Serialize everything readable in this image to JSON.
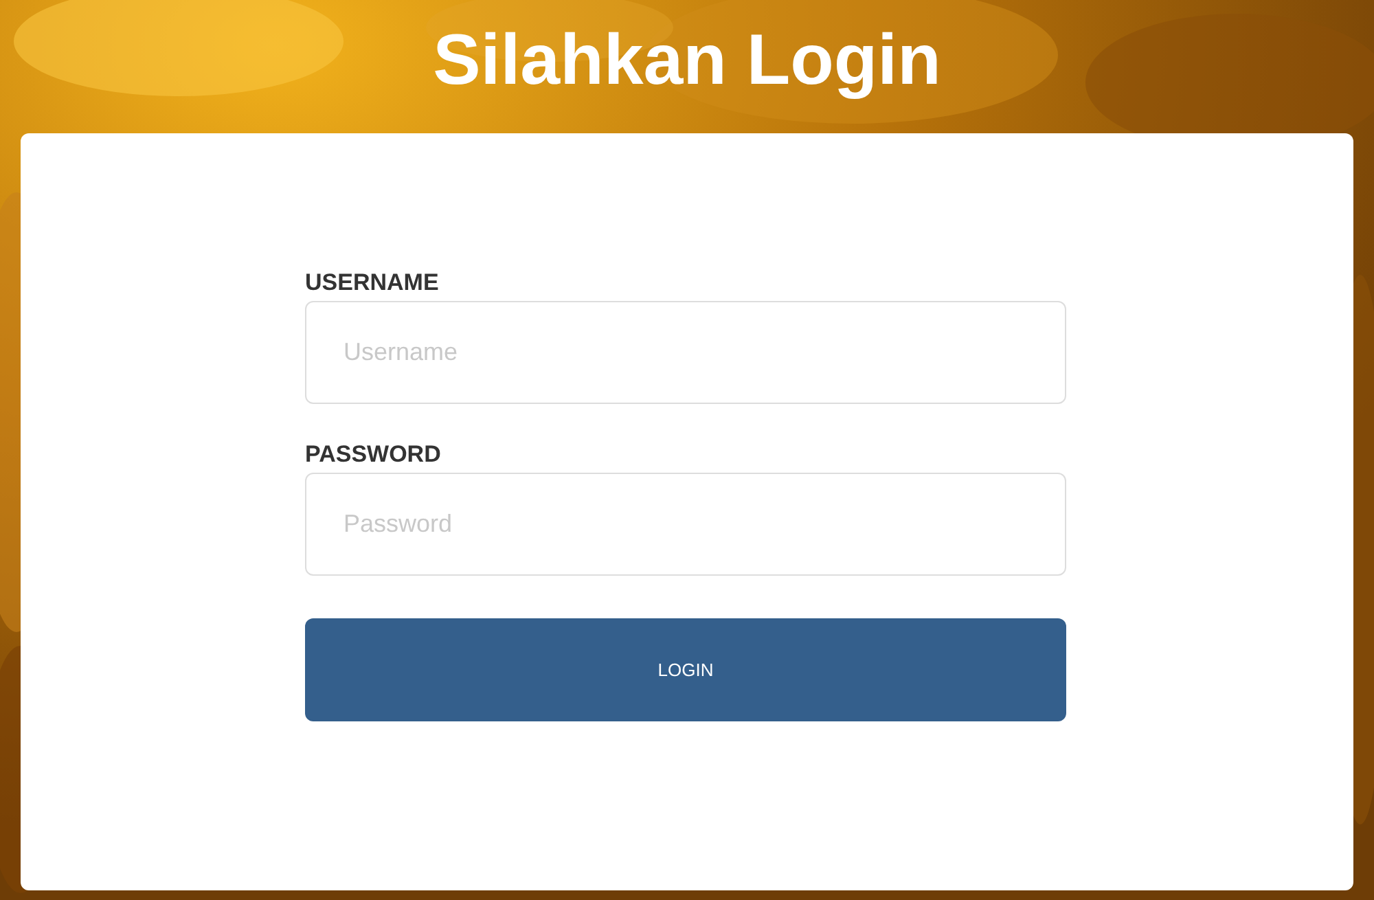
{
  "title": "Silahkan Login",
  "fields": [
    {
      "label": "USERNAME",
      "placeholder": "Username"
    },
    {
      "label": "PASSWORD",
      "placeholder": "Password"
    }
  ],
  "button": "LOGIN"
}
